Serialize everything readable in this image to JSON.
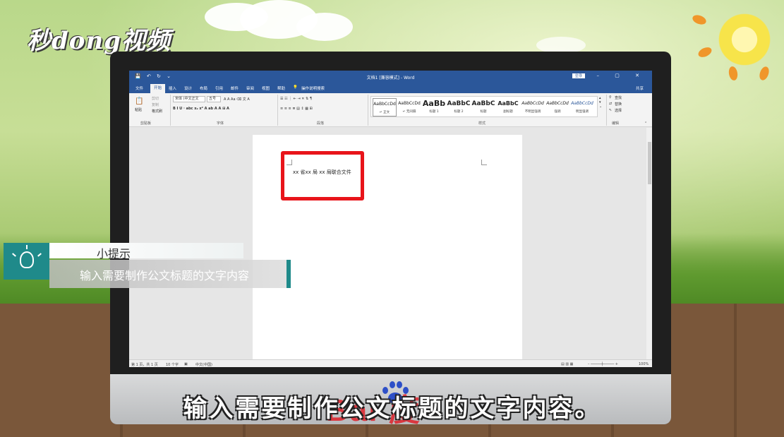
{
  "branding": {
    "logo_text": "秒dong视频"
  },
  "word": {
    "window_title": "文档1 [兼容模式] - Word",
    "sign_in_label": "登录",
    "quick_access": [
      "💾",
      "↶",
      "↻"
    ],
    "tabs": [
      {
        "label": "文件",
        "active": false
      },
      {
        "label": "开始",
        "active": true
      },
      {
        "label": "插入",
        "active": false
      },
      {
        "label": "设计",
        "active": false
      },
      {
        "label": "布局",
        "active": false
      },
      {
        "label": "引用",
        "active": false
      },
      {
        "label": "邮件",
        "active": false
      },
      {
        "label": "审阅",
        "active": false
      },
      {
        "label": "视图",
        "active": false
      },
      {
        "label": "帮助",
        "active": false
      }
    ],
    "tell_me": "操作说明搜索",
    "share_label": "共享",
    "clipboard": {
      "paste": "粘贴",
      "cut": "剪切",
      "copy": "复制",
      "format_painter": "格式刷",
      "group": "剪贴板"
    },
    "font": {
      "name": "宋体 (中文正文",
      "size": "五号",
      "group": "字体"
    },
    "paragraph": {
      "group": "段落"
    },
    "styles": {
      "group": "样式",
      "items": [
        {
          "preview": "AaBbCcDd",
          "name": "↵ 正文"
        },
        {
          "preview": "AaBbCcDd",
          "name": "↵ 无间隔"
        },
        {
          "preview": "AaBb",
          "name": "标题 1"
        },
        {
          "preview": "AaBbC",
          "name": "标题 2"
        },
        {
          "preview": "AaBbC",
          "name": "标题"
        },
        {
          "preview": "AaBbC",
          "name": "副标题"
        },
        {
          "preview": "AaBbCcDd",
          "name": "不明显强调"
        },
        {
          "preview": "AaBbCcDd",
          "name": "强调"
        },
        {
          "preview": "AaBbCcDd",
          "name": "明显强调"
        }
      ]
    },
    "editing": {
      "find": "查找",
      "replace": "替换",
      "select": "选择",
      "group": "编辑"
    },
    "document_text": "xx 省xx 局 xx 局联合文件",
    "status": {
      "page": "第 1 页，共 1 页",
      "words": "10 个字",
      "language": "中文(中国)",
      "zoom": "100%"
    }
  },
  "tip": {
    "title": "小提示",
    "body": "输入需要制作公文标题的文字内容"
  },
  "subtitle": "输入需要制作公文标题的文字内容。",
  "watermark_text": "Bai  度"
}
